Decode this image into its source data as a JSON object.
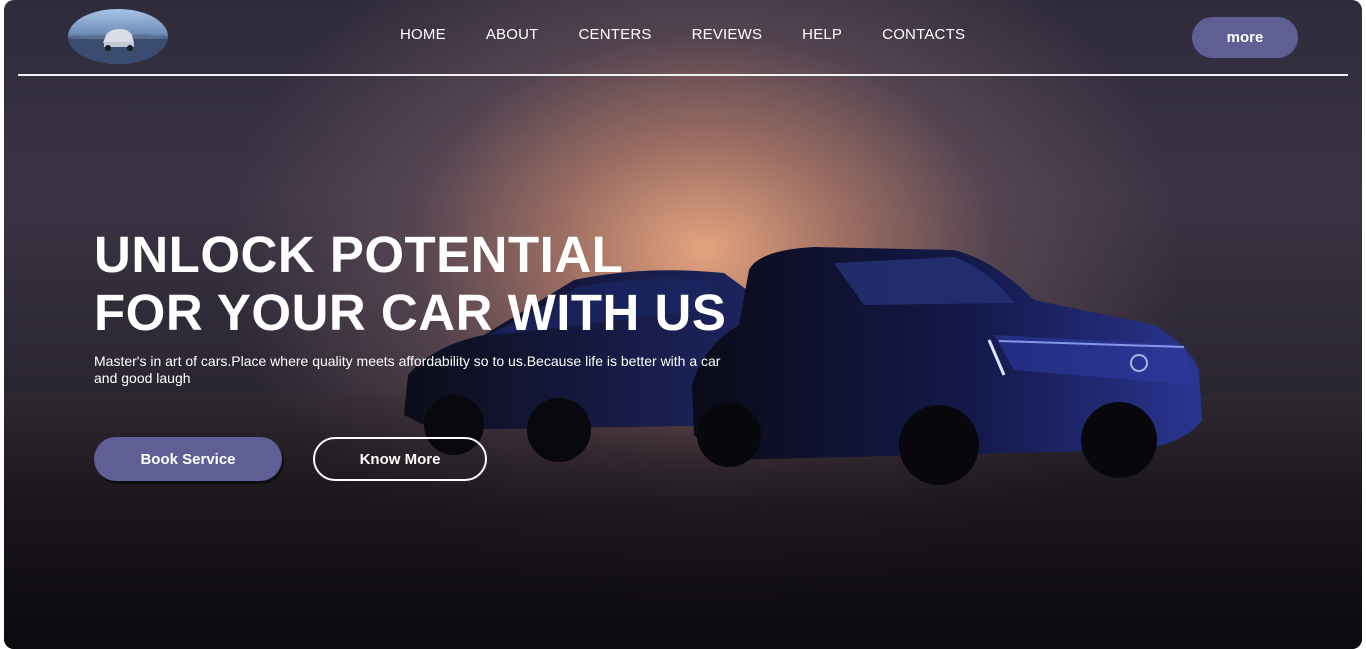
{
  "nav": {
    "logo_icon": "car-logo-icon",
    "links": [
      "HOME",
      "ABOUT",
      "CENTERS",
      "REVIEWS",
      "HELP",
      "CONTACTS"
    ],
    "more_label": "more"
  },
  "hero": {
    "title_line1": "UNLOCK POTENTIAL",
    "title_line2": "FOR YOUR CAR WITH US",
    "subtitle": "Master's in art of cars.Place where quality meets affordability so to us.Because life is better with a car and good laugh",
    "book_label": "Book Service",
    "know_label": "Know More"
  },
  "colors": {
    "accent": "#5f5f96",
    "text": "#ffffff",
    "background_dark": "#141218",
    "glow": "#ecaa82"
  }
}
